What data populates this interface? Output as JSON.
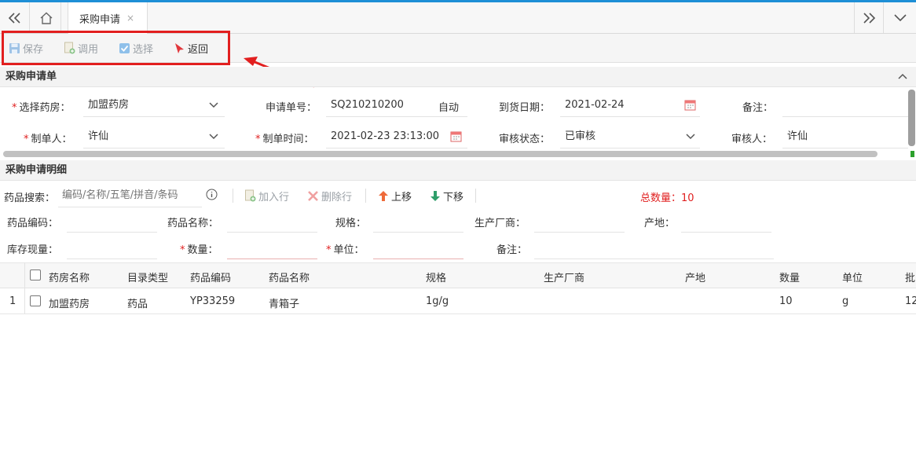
{
  "tabs": {
    "active": "采购申请",
    "close": "×"
  },
  "toolbar": {
    "save": "保存",
    "call": "调用",
    "select": "选择",
    "back": "返回"
  },
  "header_section": {
    "title": "采购申请单"
  },
  "form": {
    "pharmacy_label": "选择药房：",
    "pharmacy_value": "加盟药房",
    "req_no_label": "申请单号：",
    "req_no_value": "SQ210210200",
    "req_no_auto": "自动",
    "arrival_label": "到货日期：",
    "arrival_value": "2021-02-24",
    "remark_label": "备注：",
    "remark_value": "",
    "creator_label": "制单人：",
    "creator_value": "许仙",
    "create_time_label": "制单时间：",
    "create_time_value": "2021-02-23 23:13:00",
    "audit_status_label": "审核状态：",
    "audit_status_value": "已审核",
    "auditor_label": "审核人：",
    "auditor_value": "许仙"
  },
  "detail_section": {
    "title": "采购申请明细"
  },
  "detail_toolbar": {
    "search_label": "药品搜索：",
    "search_placeholder": "编码/名称/五笔/拼音/条码",
    "add_row": "加入行",
    "delete_row": "删除行",
    "move_up": "上移",
    "move_down": "下移",
    "total_label": "总数量：10"
  },
  "detail_form": {
    "code_label": "药品编码：",
    "name_label": "药品名称：",
    "spec_label": "规格：",
    "maker_label": "生产厂商：",
    "origin_label": "产地：",
    "stock_label": "库存现量：",
    "qty_label": "数量：",
    "unit_label": "单位：",
    "remark_label": "备注："
  },
  "table": {
    "columns": [
      "药房名称",
      "目录类型",
      "药品编码",
      "药品名称",
      "规格",
      "生产厂商",
      "产地",
      "数量",
      "单位",
      "批"
    ],
    "rows": [
      {
        "index": "1",
        "cells": [
          "加盟药房",
          "药品",
          "YP33259",
          "青箱子",
          "1g/g",
          "",
          "",
          "10",
          "g",
          "12"
        ]
      }
    ]
  },
  "colors": {
    "accent": "#1e8fd6",
    "annotation_red": "#e21f1f",
    "required": "#e02020"
  }
}
